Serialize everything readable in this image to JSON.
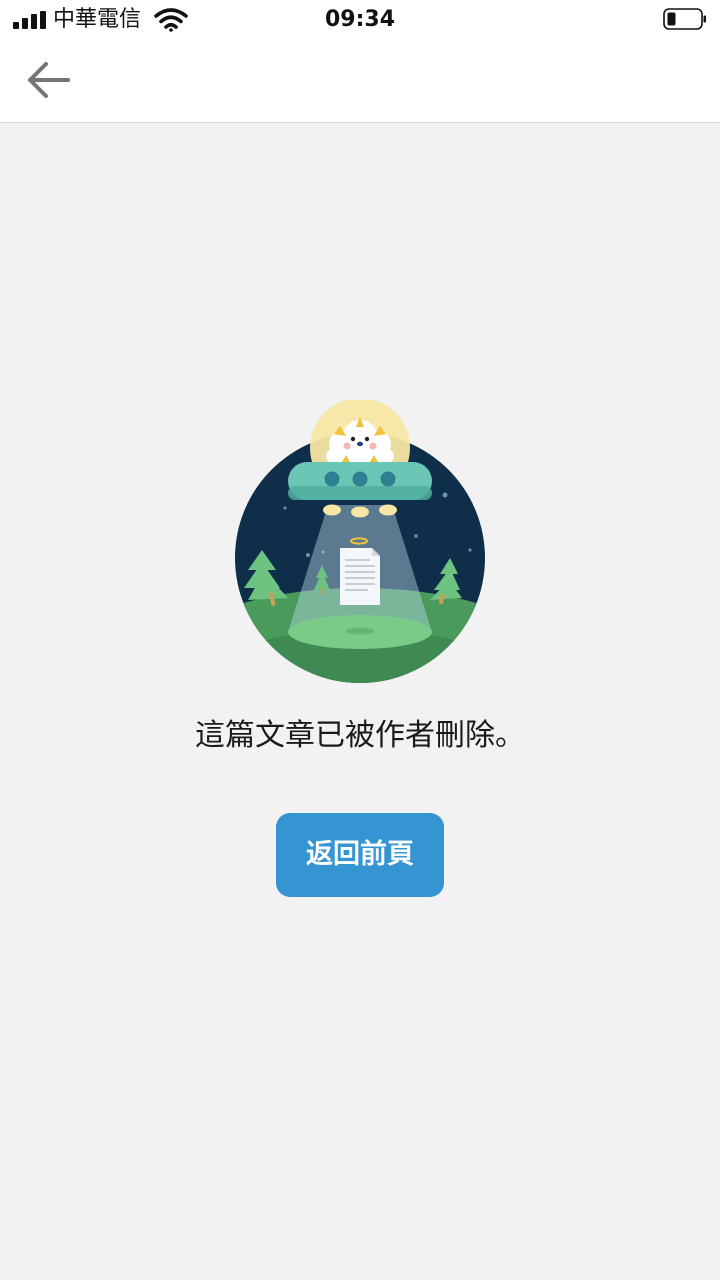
{
  "status_bar": {
    "carrier": "中華電信",
    "time": "09:34"
  },
  "nav": {
    "back_icon": "arrow-left-icon"
  },
  "main": {
    "illustration": "ufo-deleted-article-illustration",
    "message": "這篇文章已被作者刪除。",
    "back_button_label": "返回前頁"
  },
  "colors": {
    "accent": "#3595d3",
    "background": "#f2f2f2",
    "night_sky": "#0f2e49",
    "grass": "#4a9a5c"
  }
}
